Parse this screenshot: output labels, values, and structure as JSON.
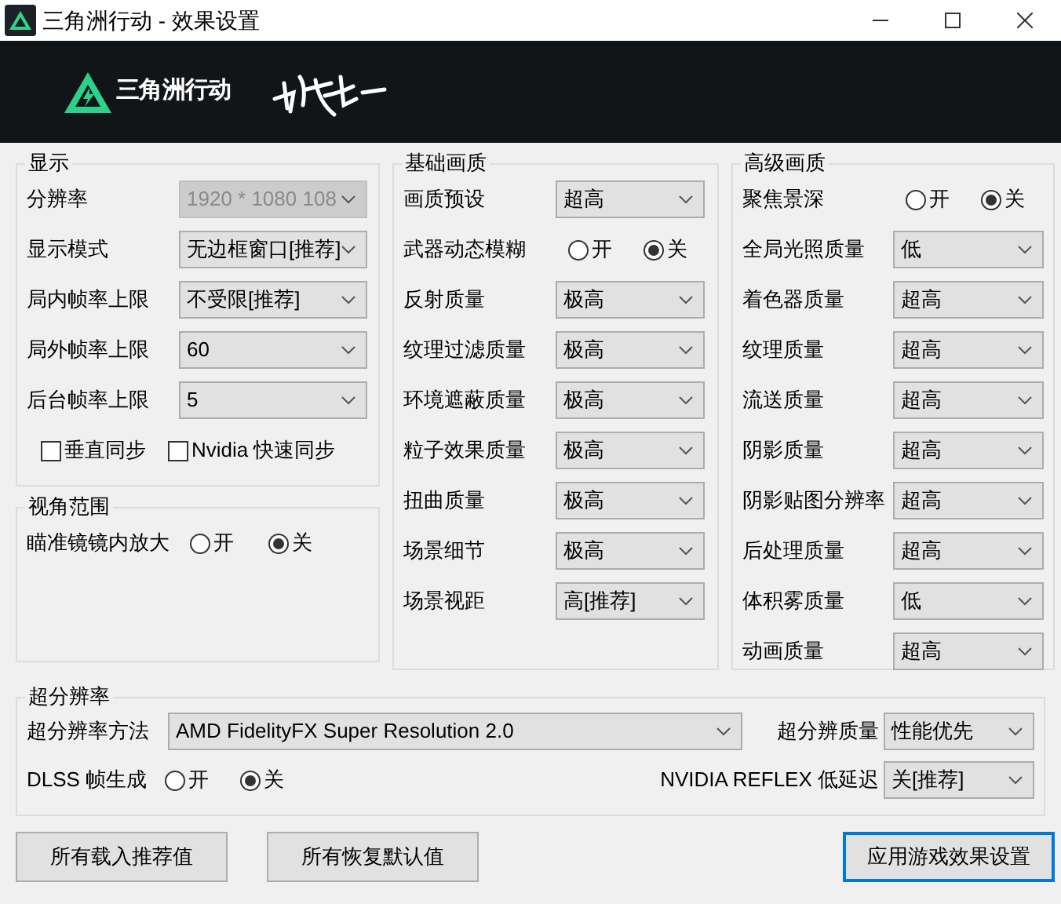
{
  "window": {
    "title": "三角洲行动 - 效果设置"
  },
  "banner": {
    "logo_text": "三角洲行动"
  },
  "display": {
    "title": "显示",
    "rows": [
      {
        "kind": "combo",
        "label": "分辨率",
        "value": "1920 * 1080 108",
        "disabled": true
      },
      {
        "kind": "combo",
        "label": "显示模式",
        "value": "无边框窗口[推荐]",
        "disabled": false
      },
      {
        "kind": "combo",
        "label": "局内帧率上限",
        "value": "不受限[推荐]",
        "disabled": false
      },
      {
        "kind": "combo",
        "label": "局外帧率上限",
        "value": "60",
        "disabled": false
      },
      {
        "kind": "combo",
        "label": "后台帧率上限",
        "value": "5",
        "disabled": false
      }
    ],
    "checkboxes": [
      {
        "label": "垂直同步",
        "checked": false
      },
      {
        "label": "Nvidia 快速同步",
        "checked": false
      }
    ]
  },
  "view": {
    "title": "视角范围",
    "rows": [
      {
        "kind": "radio",
        "label": "瞄准镜镜内放大",
        "options": [
          {
            "label": "开",
            "selected": false
          },
          {
            "label": "关",
            "selected": true
          }
        ]
      }
    ]
  },
  "basic": {
    "title": "基础画质",
    "rows": [
      {
        "kind": "combo",
        "label": "画质预设",
        "value": "超高",
        "disabled": false
      },
      {
        "kind": "radio",
        "label": "武器动态模糊",
        "options": [
          {
            "label": "开",
            "selected": false
          },
          {
            "label": "关",
            "selected": true
          }
        ]
      },
      {
        "kind": "combo",
        "label": "反射质量",
        "value": "极高",
        "disabled": false
      },
      {
        "kind": "combo",
        "label": "纹理过滤质量",
        "value": "极高",
        "disabled": false
      },
      {
        "kind": "combo",
        "label": "环境遮蔽质量",
        "value": "极高",
        "disabled": false
      },
      {
        "kind": "combo",
        "label": "粒子效果质量",
        "value": "极高",
        "disabled": false
      },
      {
        "kind": "combo",
        "label": "扭曲质量",
        "value": "极高",
        "disabled": false
      },
      {
        "kind": "combo",
        "label": "场景细节",
        "value": "极高",
        "disabled": false
      },
      {
        "kind": "combo",
        "label": "场景视距",
        "value": "高[推荐]",
        "disabled": false
      }
    ]
  },
  "advanced": {
    "title": "高级画质",
    "rows": [
      {
        "kind": "radio",
        "label": "聚焦景深",
        "options": [
          {
            "label": "开",
            "selected": false
          },
          {
            "label": "关",
            "selected": true
          }
        ]
      },
      {
        "kind": "combo",
        "label": "全局光照质量",
        "value": "低",
        "disabled": false
      },
      {
        "kind": "combo",
        "label": "着色器质量",
        "value": "超高",
        "disabled": false
      },
      {
        "kind": "combo",
        "label": "纹理质量",
        "value": "超高",
        "disabled": false
      },
      {
        "kind": "combo",
        "label": "流送质量",
        "value": "超高",
        "disabled": false
      },
      {
        "kind": "combo",
        "label": "阴影质量",
        "value": "超高",
        "disabled": false
      },
      {
        "kind": "combo",
        "label": "阴影贴图分辨率",
        "value": "超高",
        "disabled": false
      },
      {
        "kind": "combo",
        "label": "后处理质量",
        "value": "超高",
        "disabled": false
      },
      {
        "kind": "combo",
        "label": "体积雾质量",
        "value": "低",
        "disabled": false
      },
      {
        "kind": "combo",
        "label": "动画质量",
        "value": "超高",
        "disabled": false
      }
    ]
  },
  "super_resolution": {
    "title": "超分辨率",
    "method": {
      "label": "超分辨率方法",
      "value": "AMD FidelityFX Super Resolution 2.0"
    },
    "quality": {
      "label": "超分辨质量",
      "value": "性能优先"
    },
    "dlss": {
      "label": "DLSS 帧生成",
      "options": [
        {
          "label": "开",
          "selected": false
        },
        {
          "label": "关",
          "selected": true
        }
      ]
    },
    "reflex": {
      "label": "NVIDIA REFLEX 低延迟",
      "value": "关[推荐]"
    }
  },
  "buttons": [
    {
      "label": "所有载入推荐值",
      "focused": false
    },
    {
      "label": "所有恢复默认值",
      "focused": false
    },
    {
      "label": "应用游戏效果设置",
      "focused": true
    }
  ]
}
